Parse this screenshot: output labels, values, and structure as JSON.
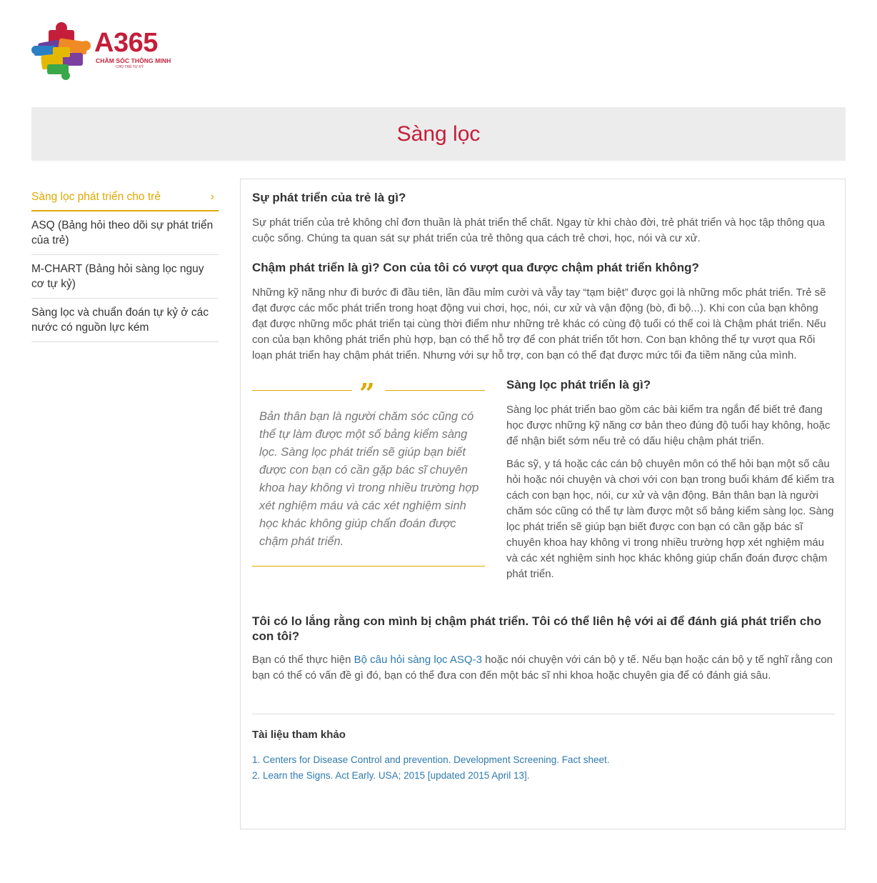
{
  "brand": {
    "name": "A365",
    "tagline": "CHĂM SÓC THÔNG MINH",
    "subtagline": "CHO TRẺ TỰ KỶ"
  },
  "page": {
    "title": "Sàng lọc"
  },
  "colors": {
    "brand_red": "#c41e3a",
    "accent_yellow": "#e0a800",
    "link_blue": "#2f7ab0",
    "banner_bg": "#ececec"
  },
  "sidebar": {
    "items": [
      {
        "label": "Sàng lọc phát triển cho trẻ",
        "active": true,
        "icon": "chevron-right-icon"
      },
      {
        "label": "ASQ (Bảng hỏi theo dõi sự phát triển của trẻ)"
      },
      {
        "label": "M-CHART (Bảng hỏi sàng lọc nguy cơ tự kỷ)"
      },
      {
        "label": "Sàng lọc và chuẩn đoán tự kỷ ở các nước có nguồn lực kém"
      }
    ]
  },
  "article": {
    "s1_title": "Sự phát triển của trẻ là gì?",
    "s1_body": "Sự phát triển của trẻ không chỉ đơn thuần là phát triển thể chất. Ngay từ khi chào đời, trẻ phát triển và học tập thông qua cuộc sống. Chúng ta quan sát sự phát triển của trẻ thông qua cách trẻ chơi, học, nói và cư xử.",
    "s2_title": "Chậm phát triển là gì? Con của tôi có vượt qua được chậm phát triển không?",
    "s2_body": "Những kỹ năng như đi bước đi đầu tiên, lần đầu mỉm cười và vẫy tay “tạm biệt” được gọi là những mốc phát triển. Trẻ sẽ đạt được các mốc phát triển trong hoạt động vui chơi, học, nói, cư xử và vận động (bò, đi bộ...). Khi con của bạn không đạt được những mốc phát triển tại cùng thời điểm như những trẻ khác có cùng độ tuổi có thể coi là Chậm phát triển. Nếu con của bạn không phát triển phù hợp, bạn có thể hỗ trợ để con phát triển tốt hơn. Con bạn không thể tự vượt qua Rối loạn phát triển hay chậm phát triển. Nhưng với sự hỗ trợ, con bạn có thể đạt được mức tối đa tiềm năng của mình.",
    "quote": "Bản thân bạn là người chăm sóc cũng có thể tự làm được một số bảng kiểm sàng lọc. Sàng lọc phát triển sẽ giúp bạn biết được con bạn có cần gặp bác sĩ chuyên khoa hay không vì trong nhiều trường hợp xét nghiệm máu và các xét nghiệm sinh học khác không giúp chẩn đoán được chậm phát triển.",
    "s3_title": "Sàng lọc phát triển là gì?",
    "s3_body1": "Sàng lọc phát triển bao gồm các bài kiểm tra ngắn để biết trẻ đang học được những kỹ năng cơ bản theo đúng độ tuổi hay không, hoặc để nhận biết sớm nếu trẻ có dấu hiệu chậm phát triển.",
    "s3_body2": "Bác sỹ, y tá hoặc các cán bộ chuyên môn có thể hỏi bạn một số câu hỏi hoặc nói chuyện và chơi với con bạn trong buổi khám để kiểm tra cách con bạn học, nói, cư xử và vận động. Bản thân bạn là người chăm sóc cũng có thể tự làm được một số bảng kiểm sàng lọc. Sàng lọc phát triển sẽ giúp bạn biết được con bạn có cần gặp bác sĩ chuyên khoa hay không vì trong nhiều trường hợp xét nghiệm máu và các xét nghiệm sinh học khác không giúp chẩn đoán được chậm phát triển.",
    "s4_title": "Tôi có lo lắng rằng con mình bị chậm phát triển. Tôi có thể liên hệ với ai để đánh giá phát triển cho con tôi?",
    "s4_body_pre": "Bạn có thể thực hiện ",
    "s4_link": "Bộ câu hỏi sàng lọc ASQ-3",
    "s4_body_post": " hoặc nói chuyện với cán bộ y tế. Nếu bạn hoặc cán bộ y tế nghĩ rằng con bạn có thể có vấn đề gì đó, bạn có thể đưa con đến một bác sĩ nhi khoa hoặc chuyên gia để có đánh giá sâu."
  },
  "references": {
    "title": "Tài liệu tham khảo",
    "items": [
      "1. Centers for Disease Control and prevention. Development Screening. Fact sheet.",
      "2. Learn the Signs. Act Early. USA; 2015 [updated 2015 April 13]."
    ]
  }
}
